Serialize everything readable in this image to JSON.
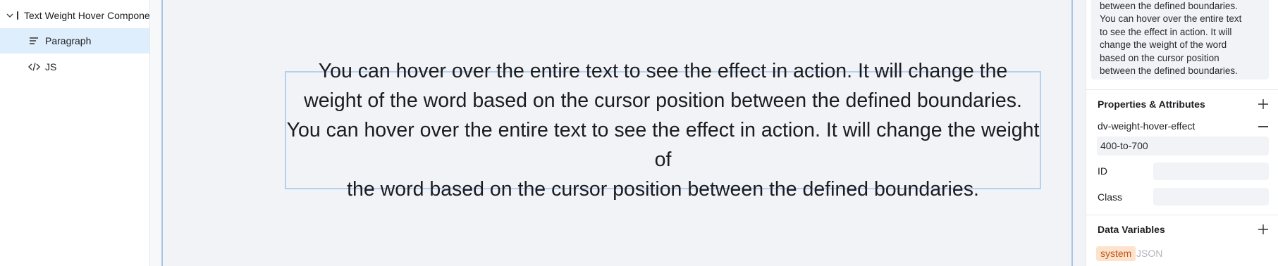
{
  "layers": {
    "items": [
      {
        "label": "Text Weight Hover Component",
        "icon": "square-icon",
        "expanded": true
      },
      {
        "label": "Paragraph",
        "icon": "paragraph-lines-icon",
        "selected": true
      },
      {
        "label": "JS",
        "icon": "code-icon"
      }
    ]
  },
  "canvas": {
    "paragraph_lines": [
      "You can hover over the entire text to see the effect in action. It will change the",
      "weight of the word based on the cursor position between the defined boundaries.",
      "You can hover over the entire text to see the effect in action. It will change the weight of",
      "the word based on the cursor position between the defined boundaries."
    ]
  },
  "panel": {
    "text_preview_lines": [
      "between the defined boundaries.",
      "You can hover over the entire text",
      "to see the effect in action. It will",
      "change the weight of the word",
      "based on the cursor position",
      "between the defined boundaries."
    ],
    "properties": {
      "title": "Properties & Attributes",
      "attribute_name": "dv-weight-hover-effect",
      "attribute_value": "400-to-700",
      "id_label": "ID",
      "id_value": "",
      "class_label": "Class",
      "class_value": ""
    },
    "data_variables": {
      "title": "Data Variables",
      "badge": "system",
      "type_label": "JSON"
    }
  },
  "colors": {
    "selection_bg": "#deeefc",
    "canvas_border": "#a8c5e7",
    "badge_bg": "#fde2cc",
    "badge_text": "#c2561c"
  }
}
